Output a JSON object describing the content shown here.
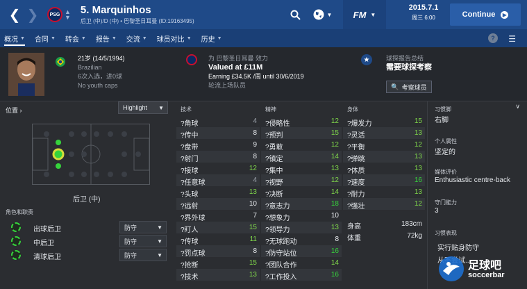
{
  "topbar": {
    "club_abbr": "PSG",
    "player_title": "5. Marquinhos",
    "player_subtitle": "后卫 (中)/D (中) • 巴黎圣日耳曼 (ID:19163495)",
    "fm_label": "FM",
    "date": "2015.7.1",
    "time": "周三 6:00",
    "continue_label": "Continue"
  },
  "tabs": [
    {
      "label": "概况"
    },
    {
      "label": "合同"
    },
    {
      "label": "转会"
    },
    {
      "label": "报告"
    },
    {
      "label": "交流"
    },
    {
      "label": "球员对比"
    },
    {
      "label": "历史"
    }
  ],
  "header": {
    "age_dob": "21岁 (14/5/1994)",
    "nationality": "Brazilian",
    "caps": "6次入选，进0球",
    "youth_caps": "No youth caps",
    "club_line": "为 巴黎圣日耳曼 效力",
    "valued": "Valued at £11M",
    "earning": "Earning £34.5K /周 until 30/6/2019",
    "squad_status": "轮流上场队员",
    "scout_title": "球探报告总结",
    "scout_value": "需要球探考察",
    "scout_button": "考察球员"
  },
  "left": {
    "position_label": "位置",
    "highlight": "Highlight",
    "position_name": "后卫 (中)",
    "roles_title": "角色和职责",
    "roles": [
      {
        "name": "出球后卫",
        "duty": "防守"
      },
      {
        "name": "中后卫",
        "duty": "防守"
      },
      {
        "name": "清球后卫",
        "duty": "防守"
      }
    ]
  },
  "technical": {
    "title": "技术",
    "rows": [
      {
        "name": "?角球",
        "value": "4"
      },
      {
        "name": "?传中",
        "value": "8"
      },
      {
        "name": "?盘带",
        "value": "9"
      },
      {
        "name": "?射门",
        "value": "8"
      },
      {
        "name": "?接球",
        "value": "12"
      },
      {
        "name": "?任意球",
        "value": "4"
      },
      {
        "name": "?头球",
        "value": "13"
      },
      {
        "name": "?远射",
        "value": "10"
      },
      {
        "name": "?界外球",
        "value": "7"
      },
      {
        "name": "?盯人",
        "value": "15"
      },
      {
        "name": "?传球",
        "value": "11"
      },
      {
        "name": "?罚点球",
        "value": "8"
      },
      {
        "name": "?抢断",
        "value": "15"
      },
      {
        "name": "?技术",
        "value": "13"
      }
    ]
  },
  "mental": {
    "title": "精神",
    "rows": [
      {
        "name": "?侵略性",
        "value": "12"
      },
      {
        "name": "?预判",
        "value": "15"
      },
      {
        "name": "?勇敢",
        "value": "12"
      },
      {
        "name": "?镇定",
        "value": "14"
      },
      {
        "name": "?集中",
        "value": "13"
      },
      {
        "name": "?视野",
        "value": "12"
      },
      {
        "name": "?决断",
        "value": "14"
      },
      {
        "name": "?意志力",
        "value": "18"
      },
      {
        "name": "?想象力",
        "value": "10"
      },
      {
        "name": "?领导力",
        "value": "13"
      },
      {
        "name": "?无球跑动",
        "value": "8"
      },
      {
        "name": "?防守站位",
        "value": "16"
      },
      {
        "name": "?团队合作",
        "value": "14"
      },
      {
        "name": "?工作投入",
        "value": "16"
      }
    ]
  },
  "physical": {
    "title": "身体",
    "rows": [
      {
        "name": "?爆发力",
        "value": "15"
      },
      {
        "name": "?灵活",
        "value": "13"
      },
      {
        "name": "?平衡",
        "value": "12"
      },
      {
        "name": "?弹跳",
        "value": "13"
      },
      {
        "name": "?体质",
        "value": "13"
      },
      {
        "name": "?速度",
        "value": "16"
      },
      {
        "name": "?耐力",
        "value": "13"
      },
      {
        "name": "?强壮",
        "value": "12"
      }
    ],
    "height_label": "身高",
    "height_value": "183cm",
    "weight_label": "体重",
    "weight_value": "72kg"
  },
  "right": {
    "foot_title": "习惯脚",
    "foot_value": "右脚",
    "personality_title": "个人属性",
    "personality_value": "坚定的",
    "media_title": "媒体评价",
    "media_value": "Enthusiastic centre-back",
    "gk_title": "守门能力",
    "gk_value": "3",
    "traits_title": "习惯表现",
    "traits": [
      "实行贴身防守",
      "从不尝试..."
    ]
  },
  "watermark": {
    "text_cn": "足球吧",
    "text_en": "soccerbar"
  },
  "colors": {
    "topbar": "#1f4a88",
    "tabbar": "#1a3f76",
    "high": "#36d33c",
    "mid": "#d7dc3a"
  }
}
